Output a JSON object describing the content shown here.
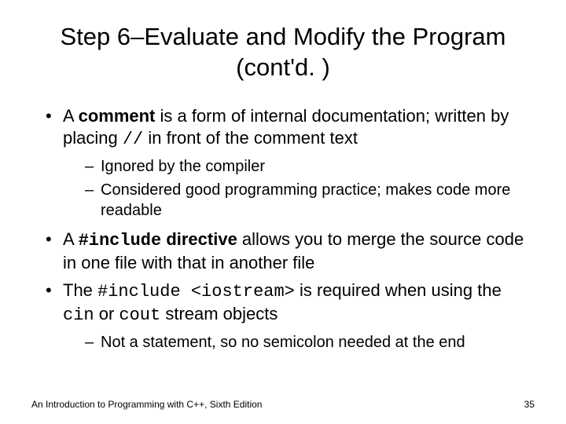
{
  "title": "Step 6–Evaluate and Modify the Program (cont'd. )",
  "bullets": [
    {
      "parts": [
        {
          "t": "A "
        },
        {
          "t": "comment",
          "bold": true
        },
        {
          "t": " is a form of internal documentation; written by placing "
        },
        {
          "t": "//",
          "code": true
        },
        {
          "t": " in front of the comment text"
        }
      ],
      "sub": [
        {
          "parts": [
            {
              "t": "Ignored by the compiler"
            }
          ]
        },
        {
          "parts": [
            {
              "t": "Considered good programming practice; makes code more readable"
            }
          ]
        }
      ]
    },
    {
      "parts": [
        {
          "t": "A "
        },
        {
          "t": "#include",
          "code": true,
          "bold": true
        },
        {
          "t": " directive",
          "bold": true
        },
        {
          "t": " allows you to merge the source code in one file with that in another file"
        }
      ]
    },
    {
      "parts": [
        {
          "t": "The "
        },
        {
          "t": "#include <iostream>",
          "code": true
        },
        {
          "t": " is required when using the "
        },
        {
          "t": "cin",
          "code": true
        },
        {
          "t": " or "
        },
        {
          "t": "cout",
          "code": true
        },
        {
          "t": " stream objects"
        }
      ],
      "sub": [
        {
          "parts": [
            {
              "t": "Not a statement, so no semicolon needed at the end"
            }
          ]
        }
      ]
    }
  ],
  "footer": {
    "left": "An Introduction to Programming with C++, Sixth Edition",
    "page": "35"
  }
}
